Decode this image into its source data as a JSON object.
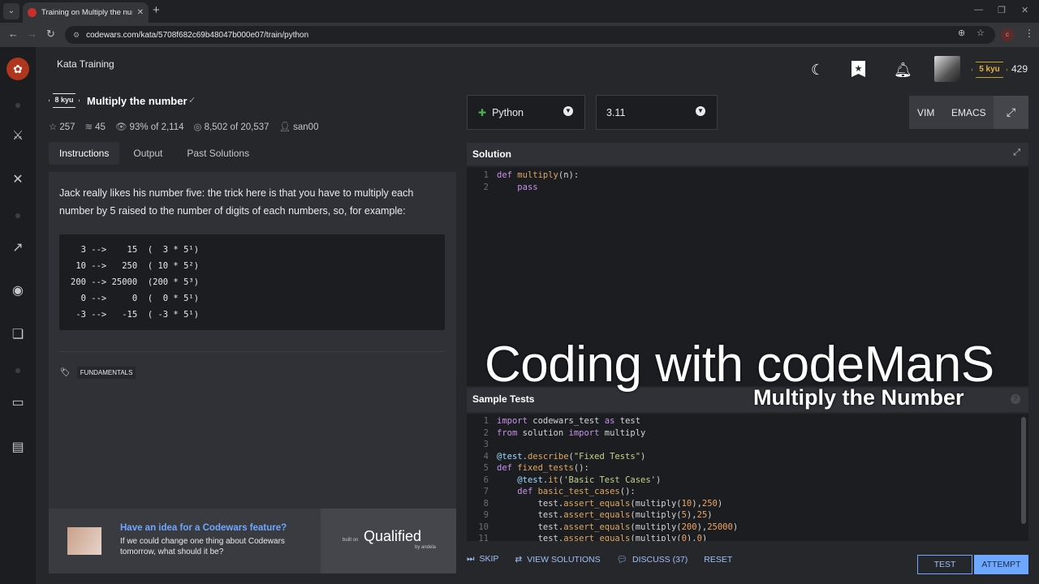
{
  "browser": {
    "tab_title": "Training on Multiply the numbe",
    "url": "codewars.com/kata/5708f682c69b48047b000e07/train/python",
    "extension_badge": "c"
  },
  "header": {
    "page_title": "Kata Training",
    "rank": "5 kyu",
    "honor": "429"
  },
  "kata": {
    "kyu": "8 kyu",
    "name": "Multiply the number",
    "stats": {
      "stars": "257",
      "collections": "45",
      "satisfaction_pct": "93%",
      "satisfaction_of": "of",
      "satisfaction_votes": "2,114",
      "completed": "8,502",
      "completed_of": "of",
      "attempted": "20,537",
      "author": "san00"
    },
    "tabs": [
      "Instructions",
      "Output",
      "Past Solutions"
    ],
    "description": "Jack really likes his number five: the trick here is that you have to multiply each number by 5 raised to the number of digits of each numbers, so, for example:",
    "example": "  3 -->    15  (  3 * 5¹)\n 10 -->   250  ( 10 * 5²)\n200 --> 25000  (200 * 5³)\n  0 -->     0  (  0 * 5¹)\n -3 -->   -15  ( -3 * 5¹)",
    "tag": "FUNDAMENTALS"
  },
  "ad": {
    "heading": "Have an idea for a Codewars feature?",
    "text": "If we could change one thing about Codewars tomorrow, what should it be?",
    "built_on": "built on",
    "brand": "Qualified",
    "by": "by andela"
  },
  "editor": {
    "language": "Python",
    "version": "3.11",
    "modes": [
      "VIM",
      "EMACS"
    ],
    "solution_title": "Solution",
    "solution_lines": [
      "1",
      "2"
    ],
    "tests_title": "Sample Tests",
    "tests_lines": [
      "1",
      "2",
      "3",
      "4",
      "5",
      "6",
      "7",
      "8",
      "9",
      "10",
      "11"
    ]
  },
  "watermark": {
    "line1": "Coding with codeManS",
    "line2": "Multiply the Number"
  },
  "actions": {
    "skip": "SKIP",
    "view_solutions": "VIEW SOLUTIONS",
    "discuss": "DISCUSS (37)",
    "reset": "RESET",
    "test": "TEST",
    "attempt": "ATTEMPT"
  },
  "colors": {
    "accent_blue": "#6ea8fe",
    "brand_red": "#b1361e",
    "rank_gold": "#c9a227"
  }
}
